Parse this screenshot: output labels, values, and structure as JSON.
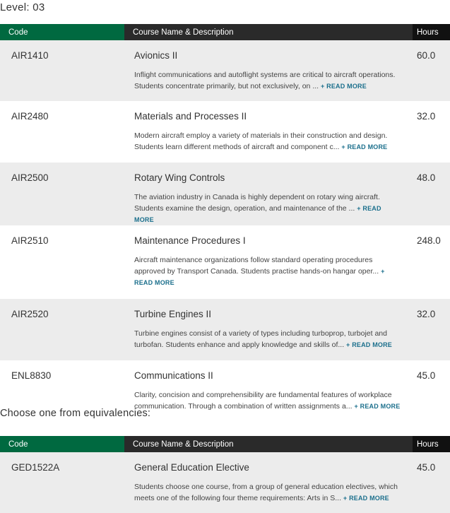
{
  "level_label": "Level: 03",
  "table_headers": {
    "code": "Code",
    "name": "Course Name & Description",
    "hours": "Hours"
  },
  "courses": [
    {
      "code": "AIR1410",
      "name": "Avionics II",
      "description": "Inflight communications and autoflight systems are critical to aircraft operations. Students concentrate primarily, but not exclusively, on ...",
      "read_more": "+ READ MORE",
      "hours": "60.0"
    },
    {
      "code": "AIR2480",
      "name": "Materials and Processes II",
      "description": "Modern aircraft employ a variety of materials in their construction and design. Students learn different methods of aircraft and component c...",
      "read_more": "+ READ MORE",
      "hours": "32.0"
    },
    {
      "code": "AIR2500",
      "name": "Rotary Wing Controls",
      "description": "The aviation industry in Canada is highly dependent on rotary wing aircraft. Students examine the design, operation, and maintenance of the ...",
      "read_more": "+ READ MORE",
      "hours": "48.0"
    },
    {
      "code": "AIR2510",
      "name": "Maintenance Procedures I",
      "description": "Aircraft maintenance organizations follow standard operating procedures approved by Transport Canada. Students practise hands-on hangar oper...",
      "read_more": "+ READ MORE",
      "hours": "248.0"
    },
    {
      "code": "AIR2520",
      "name": "Turbine Engines II",
      "description": "Turbine engines consist of a variety of types including turboprop, turbojet and turbofan. Students enhance and apply knowledge and skills of...",
      "read_more": "+ READ MORE",
      "hours": "32.0"
    },
    {
      "code": "ENL8830",
      "name": "Communications II",
      "description": "Clarity, concision and comprehensibility are fundamental features of workplace communication. Through a combination of written assignments a...",
      "read_more": "+ READ MORE",
      "hours": "45.0"
    }
  ],
  "choose_label": "Choose one from equivalencies:",
  "equivalencies": [
    {
      "code": "GED1522A",
      "name": "General Education Elective",
      "description": "Students choose one course, from a group of general education electives, which meets one of the following four theme requirements: Arts in S...",
      "read_more": "+ READ MORE",
      "hours": "45.0"
    }
  ],
  "colors": {
    "code_header": "#006940",
    "name_header": "#2a2a2a",
    "hours_header": "#111111",
    "link": "#1b6f8c"
  }
}
